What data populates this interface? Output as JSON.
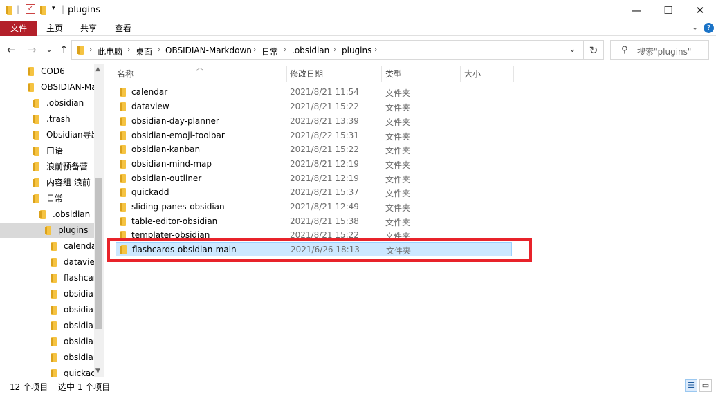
{
  "window": {
    "title": "plugins",
    "controls": {
      "minimize": "—",
      "maximize": "☐",
      "close": "✕"
    }
  },
  "ribbon": {
    "tabs": [
      {
        "label": "文件",
        "active": true
      },
      {
        "label": "主页"
      },
      {
        "label": "共享"
      },
      {
        "label": "查看"
      }
    ],
    "collapse_icon": "chevron-down-icon",
    "help_icon": "help-icon"
  },
  "toolbar": {
    "back": "←",
    "forward": "→",
    "recent": "⌄",
    "up": "↑",
    "refresh": "↻"
  },
  "address": {
    "crumbs": [
      "此电脑",
      "桌面",
      "OBSIDIAN-Markdown",
      "日常",
      ".obsidian",
      "plugins"
    ],
    "separator": "›",
    "dropdown": "⌄"
  },
  "search": {
    "placeholder": "搜索\"plugins\""
  },
  "nav_pane": {
    "items": [
      {
        "label": "COD6"
      },
      {
        "label": "OBSIDIAN-Ma"
      },
      {
        "label": ".obsidian"
      },
      {
        "label": ".trash"
      },
      {
        "label": "Obsidian导出"
      },
      {
        "label": "口语"
      },
      {
        "label": "浪前预备营"
      },
      {
        "label": "内容组 浪前"
      },
      {
        "label": "日常"
      },
      {
        "label": ".obsidian"
      },
      {
        "label": "plugins",
        "selected": true
      },
      {
        "label": "calendar"
      },
      {
        "label": "dataview"
      },
      {
        "label": "flashcard"
      },
      {
        "label": "obsidian"
      },
      {
        "label": "obsidian"
      },
      {
        "label": "obsidian"
      },
      {
        "label": "obsidian"
      },
      {
        "label": "obsidian"
      },
      {
        "label": "quickadd"
      }
    ]
  },
  "columns": {
    "name": "名称",
    "date": "修改日期",
    "type": "类型",
    "size": "大小"
  },
  "files": [
    {
      "name": "calendar",
      "date": "2021/8/21 11:54",
      "type": "文件夹"
    },
    {
      "name": "dataview",
      "date": "2021/8/21 15:22",
      "type": "文件夹"
    },
    {
      "name": "obsidian-day-planner",
      "date": "2021/8/21 13:39",
      "type": "文件夹"
    },
    {
      "name": "obsidian-emoji-toolbar",
      "date": "2021/8/22 15:31",
      "type": "文件夹"
    },
    {
      "name": "obsidian-kanban",
      "date": "2021/8/21 15:22",
      "type": "文件夹"
    },
    {
      "name": "obsidian-mind-map",
      "date": "2021/8/21 12:19",
      "type": "文件夹"
    },
    {
      "name": "obsidian-outliner",
      "date": "2021/8/21 12:19",
      "type": "文件夹"
    },
    {
      "name": "quickadd",
      "date": "2021/8/21 15:37",
      "type": "文件夹"
    },
    {
      "name": "sliding-panes-obsidian",
      "date": "2021/8/21 12:49",
      "type": "文件夹"
    },
    {
      "name": "table-editor-obsidian",
      "date": "2021/8/21 15:38",
      "type": "文件夹"
    },
    {
      "name": "templater-obsidian",
      "date": "2021/8/21 15:22",
      "type": "文件夹"
    },
    {
      "name": "flashcards-obsidian-main",
      "date": "2021/6/26 18:13",
      "type": "文件夹",
      "selected": true
    }
  ],
  "status": {
    "count": "12 个项目",
    "selected": "选中 1 个项目"
  },
  "colors": {
    "file_tab": "#b3202a",
    "selection": "#cce8ff",
    "highlight_box": "#e8232a",
    "folder": "#f5c342"
  }
}
